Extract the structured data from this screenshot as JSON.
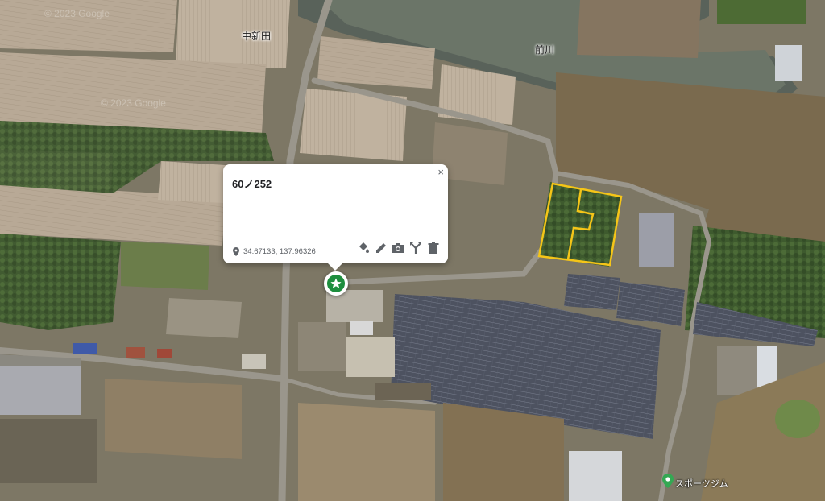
{
  "map": {
    "type": "satellite",
    "watermarks": [
      "© 2023 Google",
      "© 2023 Google"
    ],
    "labels": {
      "area_name": "中新田",
      "river_name": "前川",
      "poi_name": "スポーツジム"
    },
    "polygon_color": "#f5c518",
    "poi_marker_color": "#34a853"
  },
  "popup": {
    "title": "60ノ252",
    "coordinates": "34.67133, 137.96326",
    "close_glyph": "×",
    "tools": [
      "paint-bucket-icon",
      "pencil-icon",
      "camera-icon",
      "route-icon",
      "trash-icon"
    ]
  },
  "marker": {
    "icon": "star-icon",
    "color": "#1e8e3e"
  }
}
